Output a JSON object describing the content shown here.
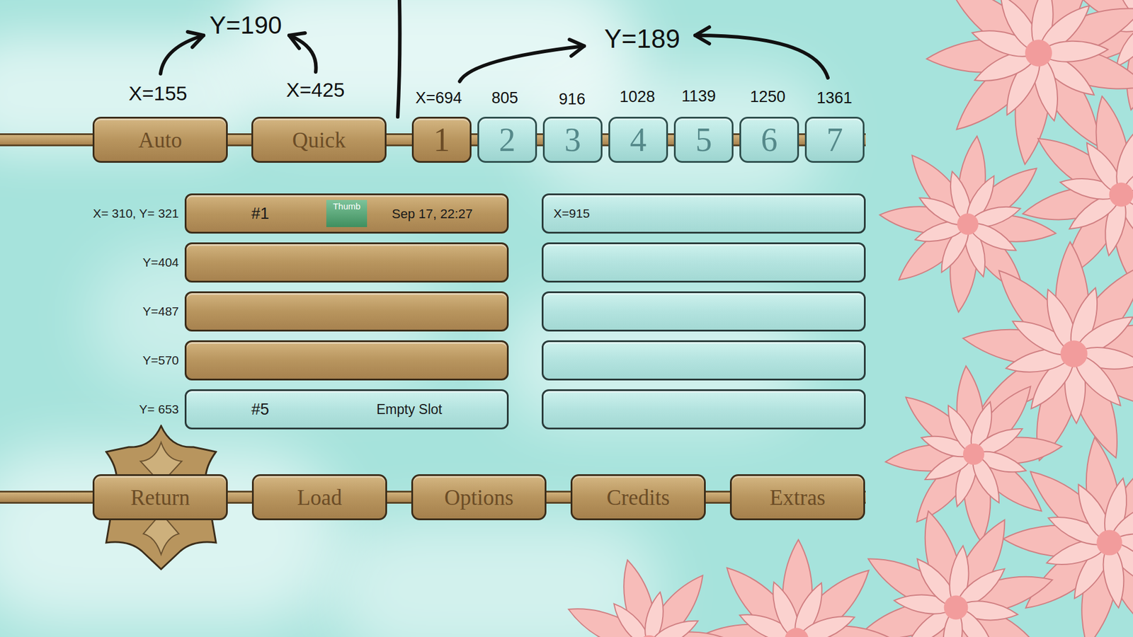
{
  "annotations": [
    {
      "text": "Y=190"
    },
    {
      "text": "X=155"
    },
    {
      "text": "X=425"
    },
    {
      "text": "X=694"
    },
    {
      "text": "805"
    },
    {
      "text": "916"
    },
    {
      "text": "1028"
    },
    {
      "text": "1139"
    },
    {
      "text": "1250"
    },
    {
      "text": "1361"
    },
    {
      "text": "Y=189"
    }
  ],
  "top_buttons": [
    {
      "label": "Auto"
    },
    {
      "label": "Quick"
    }
  ],
  "pages": [
    {
      "label": "1",
      "selected": true
    },
    {
      "label": "2",
      "selected": false
    },
    {
      "label": "3",
      "selected": false
    },
    {
      "label": "4",
      "selected": false
    },
    {
      "label": "5",
      "selected": false
    },
    {
      "label": "6",
      "selected": false
    },
    {
      "label": "7",
      "selected": false
    }
  ],
  "row_labels": [
    "X= 310, Y= 321",
    "Y=404",
    "Y=487",
    "Y=570",
    "Y= 653"
  ],
  "slots_left": [
    {
      "number": "#1",
      "thumb": "Thumb",
      "date": "Sep 17, 22:27",
      "filled": true
    },
    {
      "filled": true
    },
    {
      "filled": true
    },
    {
      "filled": true
    },
    {
      "number": "#5",
      "status": "Empty Slot",
      "filled": false
    }
  ],
  "slots_right": [
    {
      "note": "X=915",
      "filled": false
    },
    {
      "filled": false
    },
    {
      "filled": false
    },
    {
      "filled": false
    },
    {
      "filled": false
    }
  ],
  "bottom_buttons": [
    {
      "label": "Return",
      "selected": true
    },
    {
      "label": "Load",
      "selected": false
    },
    {
      "label": "Options",
      "selected": false
    },
    {
      "label": "Credits",
      "selected": false
    },
    {
      "label": "Extras",
      "selected": false
    }
  ]
}
